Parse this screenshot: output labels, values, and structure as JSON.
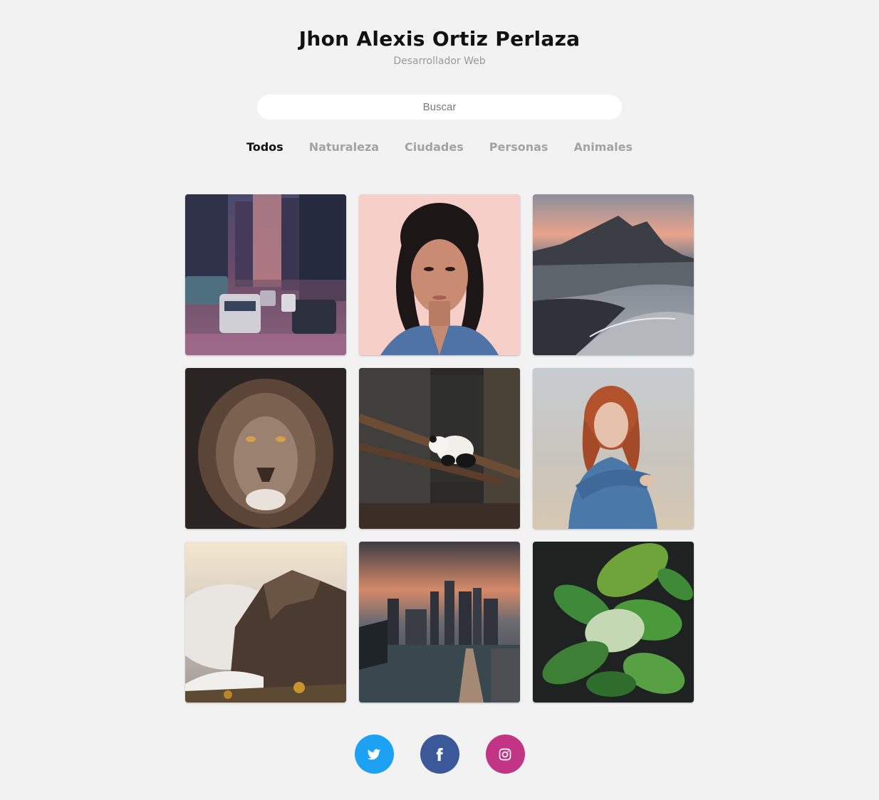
{
  "header": {
    "name": "Jhon Alexis Ortiz Perlaza",
    "role": "Desarrollador Web"
  },
  "search": {
    "placeholder": "Buscar",
    "value": ""
  },
  "filters": [
    {
      "label": "Todos",
      "active": true
    },
    {
      "label": "Naturaleza",
      "active": false
    },
    {
      "label": "Ciudades",
      "active": false
    },
    {
      "label": "Personas",
      "active": false
    },
    {
      "label": "Animales",
      "active": false
    }
  ],
  "gallery": [
    {
      "subject": "city street with taxis",
      "category": "Ciudades"
    },
    {
      "subject": "woman portrait denim jacket",
      "category": "Personas"
    },
    {
      "subject": "mountain black sand beach",
      "category": "Naturaleza"
    },
    {
      "subject": "lion face",
      "category": "Animales"
    },
    {
      "subject": "panda on bamboo",
      "category": "Animales"
    },
    {
      "subject": "red-haired woman blue sweater",
      "category": "Personas"
    },
    {
      "subject": "cliff above clouds",
      "category": "Naturaleza"
    },
    {
      "subject": "city skyline at sunset",
      "category": "Ciudades"
    },
    {
      "subject": "green leaves",
      "category": "Naturaleza"
    }
  ],
  "social": [
    {
      "icon": "twitter-icon",
      "color": "#1da1f2"
    },
    {
      "icon": "facebook-icon",
      "color": "#3b5998"
    },
    {
      "icon": "instagram-icon",
      "color": "#c13584"
    }
  ]
}
